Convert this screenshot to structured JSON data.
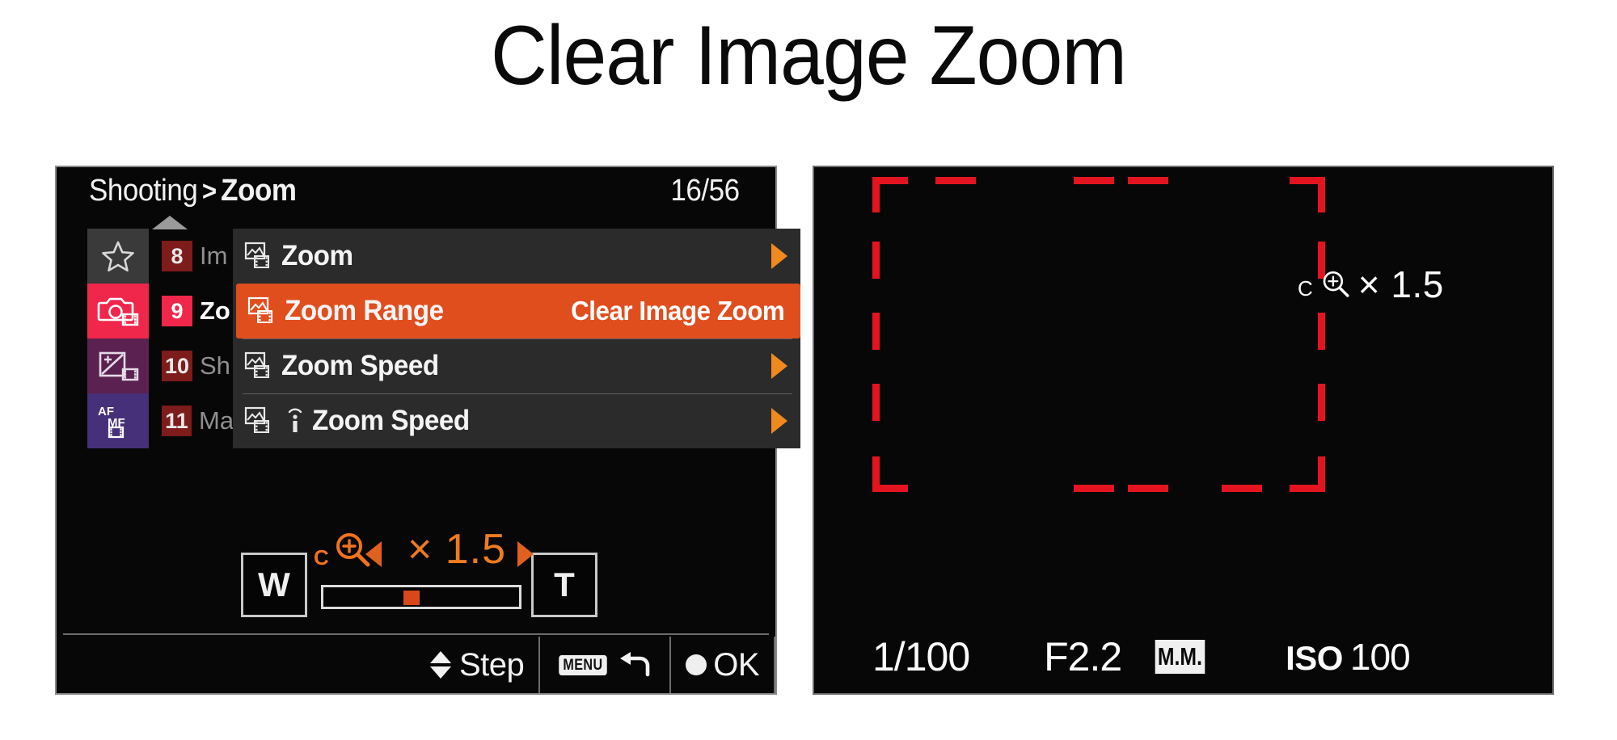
{
  "page": {
    "title": "Clear Image Zoom",
    "accent_orange": "#e04e1e",
    "accent_amber": "#f08a1e",
    "accent_red": "#f0274a",
    "frame_red": "#e31420"
  },
  "menu_panel": {
    "breadcrumb": {
      "crumb_1": "Shooting",
      "separator": ">",
      "crumb_2": "Zoom"
    },
    "page_count": "16/56",
    "tabs": [
      {
        "name": "favorites-tab",
        "icon": "star-icon",
        "color": "#3a3a3a",
        "active": false
      },
      {
        "name": "shooting-tab",
        "icon": "camera-movie-icon",
        "color": "#f0274a",
        "active": true
      },
      {
        "name": "exposure-tab",
        "icon": "exposure-movie-icon",
        "color": "#5b2150",
        "active": false
      },
      {
        "name": "focus-tab",
        "icon": "af-mf-movie-icon",
        "color": "#463079",
        "active": false
      }
    ],
    "groups": [
      {
        "number": "8",
        "label": "Im",
        "active": false
      },
      {
        "number": "9",
        "label": "Zo",
        "active": true
      },
      {
        "number": "10",
        "label": "Sh",
        "active": false
      },
      {
        "number": "11",
        "label": "Ma",
        "active": false
      }
    ],
    "rows": [
      {
        "label": "Zoom",
        "icon": "movie-zoom-icon",
        "value": "",
        "caret": true,
        "selected": false,
        "remote": false
      },
      {
        "label": "Zoom Range",
        "icon": "movie-zoom-icon",
        "value": "Clear Image Zoom",
        "caret": false,
        "selected": true,
        "remote": false
      },
      {
        "label": "Zoom Speed",
        "icon": "movie-zoom-icon",
        "value": "",
        "caret": true,
        "selected": false,
        "remote": false
      },
      {
        "label": "Zoom Speed",
        "icon": "movie-zoom-icon",
        "value": "",
        "caret": true,
        "selected": false,
        "remote": true
      }
    ],
    "zoom_control": {
      "wide_label": "W",
      "tele_label": "T",
      "badge_letter": "C",
      "badge_icon": "magnifier-plus-icon",
      "value": "× 1.5",
      "slider_percent": 45,
      "left_arrow": "left-triangle-icon",
      "right_arrow": "right-triangle-icon"
    },
    "bottom_bar": {
      "step_label": "Step",
      "menu_chip": "MENU",
      "back_icon": "back-arrow-icon",
      "ok_label": "OK",
      "ok_dot": "circle-dot-icon"
    }
  },
  "live_view": {
    "zoom_indicator": {
      "badge_letter": "C",
      "badge_icon": "magnifier-plus-icon",
      "value": "× 1.5"
    },
    "shutter": "1/100",
    "aperture": "F2.2",
    "metering_mode": "M.M.",
    "iso_word": "ISO",
    "iso_value": "100"
  }
}
